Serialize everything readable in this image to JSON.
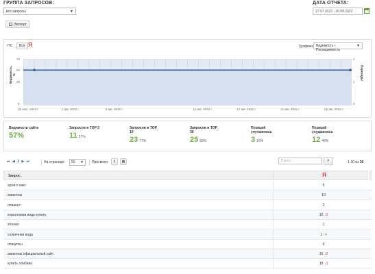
{
  "header": {
    "group_title": "ГРУППА ЗАПРОСОВ:",
    "group_value": "все запросы",
    "date_title": "ДАТА ОТЧЕТА:",
    "date_value": "27.07.2022 - 26.08.2022"
  },
  "toolbar": {
    "export_label": "Экспорт"
  },
  "chart_controls": {
    "ps_label": "ПС:",
    "ps_value": "Все",
    "yandex_glyph": "Я",
    "graphs_label": "Графики:",
    "graphs_value": "Видимость / Посещаемость"
  },
  "chart_data": {
    "type": "line",
    "ylabel": "Видимость, %",
    "y2label": "Переходы",
    "ylim": [
      0,
      75
    ],
    "yticks": [
      "75",
      "50",
      "25",
      "0"
    ],
    "y2ticks": [
      "2",
      "1",
      "0"
    ],
    "xticks": [
      "28 июл. 2022 г.",
      "1 авг. 2022 г.",
      "5 авг. 2022 г.",
      "13 авг. 2022 г.",
      "17 авг. 2022 г.",
      "21 авг. 2022 г.",
      "25 авг. 2022 г."
    ],
    "xtick_days": [
      1,
      5,
      9,
      17,
      21,
      25,
      29
    ],
    "series": [
      {
        "color": "#2a5ea8",
        "values": [
          57,
          57,
          57,
          57,
          57,
          57,
          57,
          57,
          57,
          57,
          57,
          57,
          57,
          57,
          57,
          57,
          57,
          57,
          57,
          57,
          57,
          57,
          57,
          57,
          57,
          57,
          57,
          57,
          57,
          57,
          57
        ]
      }
    ]
  },
  "stats": [
    {
      "label": "Видимость сайта",
      "big": "57%",
      "small": ""
    },
    {
      "label": "Запросов в TOP 3",
      "big": "11",
      "small": "37%"
    },
    {
      "label": "Запросов в TOP 10",
      "big": "23",
      "small": "77%"
    },
    {
      "label": "Запросов в TOP 30",
      "big": "25",
      "small": "83%"
    },
    {
      "label": "Позиций улучшилось",
      "big": "3",
      "small": "10%"
    },
    {
      "label": "Позиций ухудшилось",
      "big": "12",
      "small": "40%"
    }
  ],
  "pager": {
    "first": "⏮",
    "prev": "◀",
    "page": "1",
    "next": "▶",
    "last": "⏭",
    "per_page_label": "На странице:",
    "per_page_value": "50",
    "view_label": "Просмотр:",
    "search_placeholder": "Поиск...",
    "range_text": "1-30 из",
    "range_total": "30"
  },
  "table": {
    "col_query": "Запрос",
    "col_yandex": "Я",
    "rows": [
      {
        "query": "аргинт накс",
        "pos": "5",
        "delta": "",
        "dir": ""
      },
      {
        "query": "аквагены",
        "pos": "10",
        "delta": "",
        "dir": ""
      },
      {
        "query": "олиаент",
        "pos": "2",
        "delta": "",
        "dir": ""
      },
      {
        "query": "коралловая вода купить",
        "pos": "10",
        "delta": "2",
        "dir": "down"
      },
      {
        "query": "хлонил",
        "pos": "1",
        "delta": "",
        "dir": ""
      },
      {
        "query": "солнечная вода",
        "pos": "1",
        "delta": "4",
        "dir": "up"
      },
      {
        "query": "олицитен",
        "pos": "6",
        "delta": "",
        "dir": ""
      },
      {
        "query": "аквагены официальный сайт",
        "pos": "16",
        "delta": "2",
        "dir": "down"
      },
      {
        "query": "купить олибиан",
        "pos": "18",
        "delta": "3",
        "dir": "down"
      }
    ]
  }
}
